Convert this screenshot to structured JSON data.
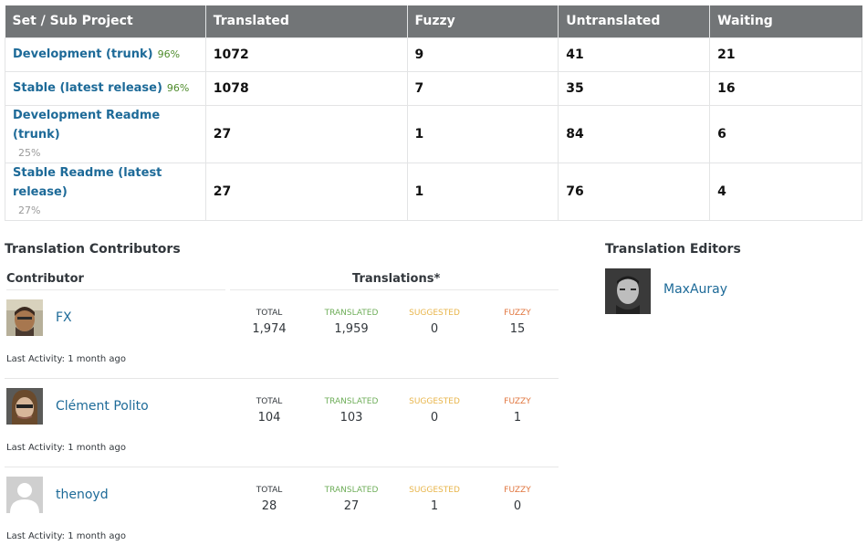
{
  "stats_table": {
    "headers": [
      "Set / Sub Project",
      "Translated",
      "Fuzzy",
      "Untranslated",
      "Waiting"
    ],
    "rows": [
      {
        "name": "Development (trunk)",
        "percent": "96%",
        "translated": "1072",
        "fuzzy": "9",
        "untranslated": "41",
        "waiting": "21"
      },
      {
        "name": "Stable (latest release)",
        "percent": "96%",
        "translated": "1078",
        "fuzzy": "7",
        "untranslated": "35",
        "waiting": "16"
      },
      {
        "name": "Development Readme (trunk)",
        "percent": "25%",
        "translated": "27",
        "fuzzy": "1",
        "untranslated": "84",
        "waiting": "6"
      },
      {
        "name": "Stable Readme (latest release)",
        "percent": "27%",
        "translated": "27",
        "fuzzy": "1",
        "untranslated": "76",
        "waiting": "4"
      }
    ],
    "colors": {
      "header_bg": "#727577",
      "link": "#1d6a98",
      "percent_high": "#4f8c2c",
      "percent_low": "#9a9a9a"
    }
  },
  "contributors": {
    "title": "Translation Contributors",
    "col_contributor": "Contributor",
    "col_translations": "Translations*",
    "stat_labels": {
      "total": "Total",
      "translated": "Translated",
      "suggested": "Suggested",
      "fuzzy": "Fuzzy"
    },
    "items": [
      {
        "name": "FX",
        "avatar": "avatar-photo",
        "total": "1,974",
        "translated": "1,959",
        "suggested": "0",
        "fuzzy": "15",
        "activity": "Last Activity: 1 month ago"
      },
      {
        "name": "Clément Polito",
        "avatar": "avatar-photo",
        "total": "104",
        "translated": "103",
        "suggested": "0",
        "fuzzy": "1",
        "activity": "Last Activity: 1 month ago"
      },
      {
        "name": "thenoyd",
        "avatar": "default-avatar-icon",
        "total": "28",
        "translated": "27",
        "suggested": "1",
        "fuzzy": "0",
        "activity": "Last Activity: 1 month ago"
      }
    ]
  },
  "editors": {
    "title": "Translation Editors",
    "items": [
      {
        "name": "MaxAuray",
        "avatar": "avatar-photo"
      }
    ]
  }
}
